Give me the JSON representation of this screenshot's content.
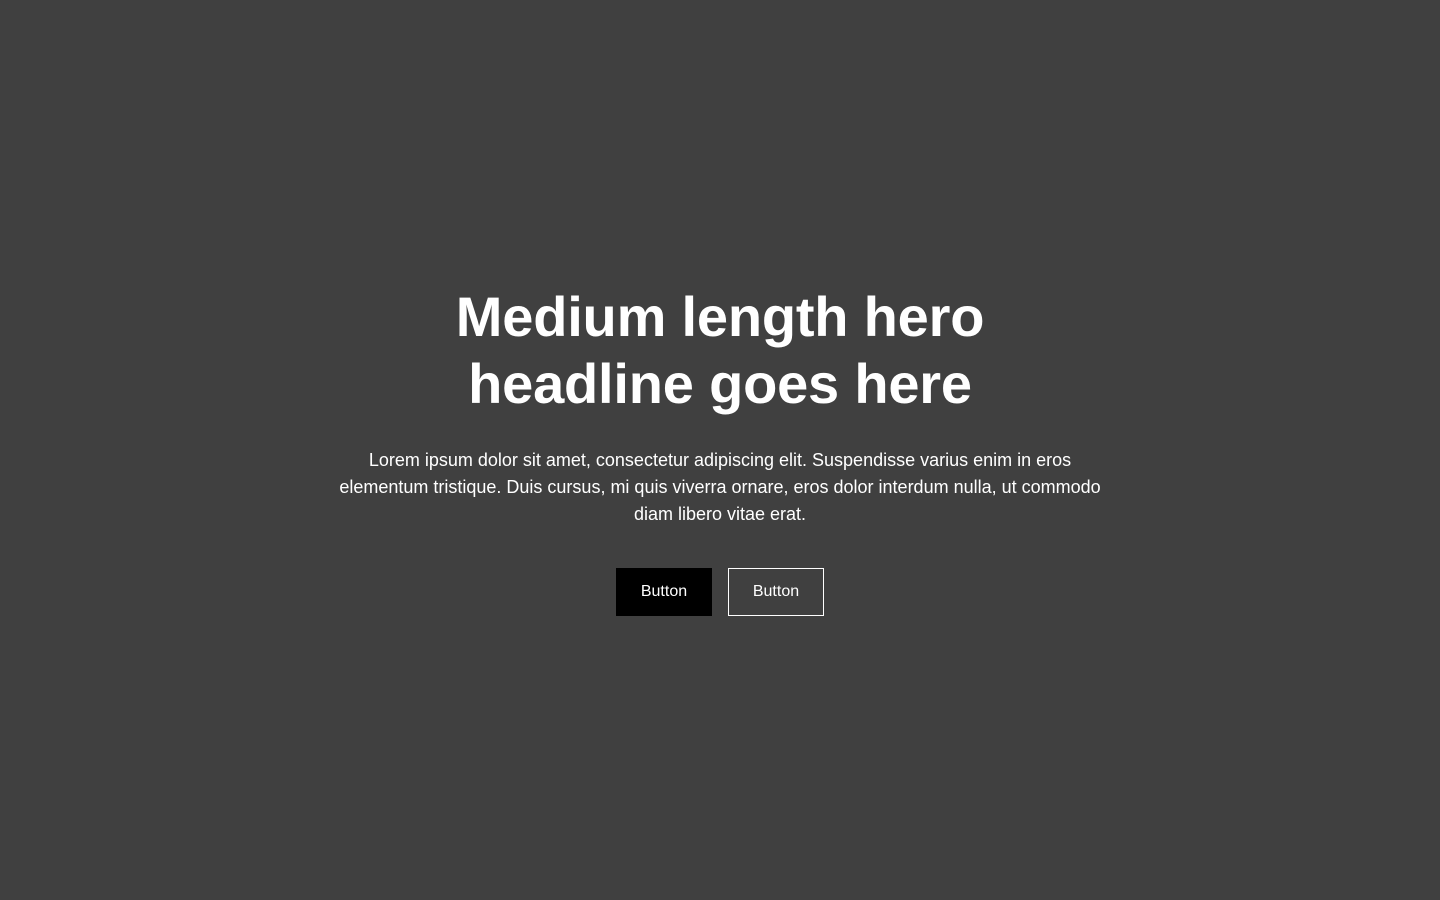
{
  "theme": {
    "background": "#404040",
    "text": "#ffffff",
    "primary_button_bg": "#000000",
    "secondary_button_border": "#ffffff"
  },
  "hero": {
    "headline": "Medium length hero headline goes here",
    "body": "Lorem ipsum dolor sit amet, consectetur adipiscing elit. Suspendisse varius enim in eros elementum tristique. Duis cursus, mi quis viverra ornare, eros dolor interdum nulla, ut commodo diam libero vitae erat.",
    "primary_button_label": "Button",
    "secondary_button_label": "Button"
  }
}
